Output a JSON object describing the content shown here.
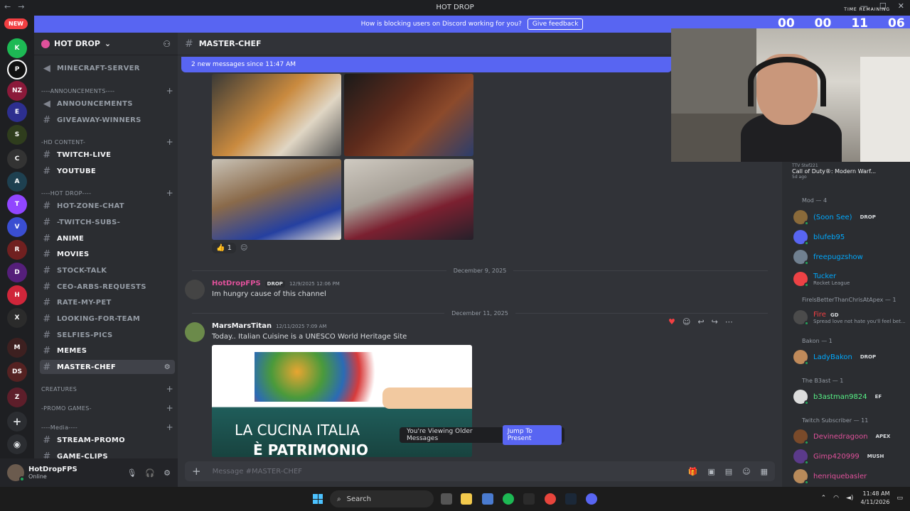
{
  "window": {
    "title": "HOT DROP",
    "back": "←",
    "forward": "→",
    "controls": [
      "—",
      "☐",
      "✕"
    ]
  },
  "guild_rail": {
    "new_badge": "NEW"
  },
  "banner": {
    "text": "How is blocking users on Discord working for you?",
    "button": "Give feedback"
  },
  "server": {
    "name": "HOT DROP"
  },
  "channels": {
    "items": [
      {
        "label": "MINECRAFT-SERVER",
        "type": "announce"
      },
      {
        "label": "----ANNOUNCEMENTS----",
        "type": "category"
      },
      {
        "label": "ANNOUNCEMENTS",
        "type": "announce"
      },
      {
        "label": "GIVEAWAY-WINNERS",
        "type": "text"
      },
      {
        "label": "-HD CONTENT-",
        "type": "category"
      },
      {
        "label": "TWITCH-LIVE",
        "type": "text"
      },
      {
        "label": "YOUTUBE",
        "type": "text"
      },
      {
        "label": "----HOT DROP----",
        "type": "category"
      },
      {
        "label": "HOT-ZONE-CHAT",
        "type": "text"
      },
      {
        "label": "-TWITCH-SUBS-",
        "type": "text"
      },
      {
        "label": "ANIME",
        "type": "text"
      },
      {
        "label": "MOVIES",
        "type": "text"
      },
      {
        "label": "STOCK-TALK",
        "type": "text"
      },
      {
        "label": "CEO-ARBS-REQUESTS",
        "type": "text"
      },
      {
        "label": "RATE-MY-PET",
        "type": "text"
      },
      {
        "label": "LOOKING-FOR-TEAM",
        "type": "text"
      },
      {
        "label": "SELFIES-PICS",
        "type": "text"
      },
      {
        "label": "MEMES",
        "type": "text"
      },
      {
        "label": "MASTER-CHEF",
        "type": "text"
      },
      {
        "label": "CREATURES",
        "type": "category"
      },
      {
        "label": "-PROMO GAMES-",
        "type": "category"
      },
      {
        "label": "----Media----",
        "type": "category"
      },
      {
        "label": "STREAM-PROMO",
        "type": "text"
      },
      {
        "label": "GAME-CLIPS",
        "type": "text"
      }
    ]
  },
  "user": {
    "name": "HotDropFPS",
    "status": "Online"
  },
  "channel_header": {
    "name": "MASTER-CHEF"
  },
  "new_messages_bar": "2 new messages since 11:47 AM",
  "reactions": {
    "thumbs_count": "1"
  },
  "dividers": {
    "d1": "December 9, 2025",
    "d2": "December 11, 2025"
  },
  "messages": [
    {
      "author": "HotDropFPS",
      "tag": "DROP",
      "time": "12/9/2025 12:06 PM",
      "text": "Im hungry cause of this channel"
    },
    {
      "author": "MarsMarsTitan",
      "time": "12/11/2025 7:09 AM",
      "text": "Today.. Italian Cuisine is a UNESCO World Heritage Site"
    }
  ],
  "embed": {
    "line1": "LA CUCINA ITALIA",
    "line2": "È PATRIMONIO"
  },
  "older_banner": {
    "text": "You're Viewing Older Messages",
    "button": "Jump To Present"
  },
  "composer": {
    "placeholder": "Message #MASTER-CHEF"
  },
  "members": {
    "activity_user": "TTV Stef221",
    "activity_game": "Call of Duty®: Modern Warf...",
    "activity_time": "5d ago",
    "categories": [
      {
        "label": "Mod — 4"
      },
      {
        "label": "FirelsBetterThanChrisAtApex — 1"
      },
      {
        "label": "Bakon — 1"
      },
      {
        "label": "The B3ast — 1"
      },
      {
        "label": "Twitch Subscriber — 11"
      }
    ],
    "list": [
      {
        "name": "(Soon See)",
        "tag": "DROP",
        "color": "#00a8fc"
      },
      {
        "name": "blufeb95",
        "color": "#00a8fc"
      },
      {
        "name": "freepugzshow",
        "color": "#00a8fc"
      },
      {
        "name": "Tucker",
        "sub": "Rocket League",
        "color": "#00a8fc"
      },
      {
        "name": "Fire",
        "tag": "GD",
        "sub": "Spread love not hate you'll feel bet...",
        "color": "#f23f42"
      },
      {
        "name": "LadyBakon",
        "tag": "DROP",
        "color": "#00a8fc"
      },
      {
        "name": "b3astman9824",
        "tag": "EF",
        "color": "#57f287"
      },
      {
        "name": "Devinedragoon",
        "tag": "APEX",
        "color": "#e0519b"
      },
      {
        "name": "Gimp420999",
        "tag": "MUSH",
        "color": "#e0519b"
      },
      {
        "name": "henriquebasler",
        "color": "#e0519b"
      }
    ]
  },
  "timer": {
    "label": "TIME REMAINING",
    "h": "00",
    "m": "00",
    "s": "11",
    "ms": "06"
  },
  "taskbar": {
    "search": "Search",
    "time": "11:48 AM",
    "date": "4/11/2026"
  }
}
